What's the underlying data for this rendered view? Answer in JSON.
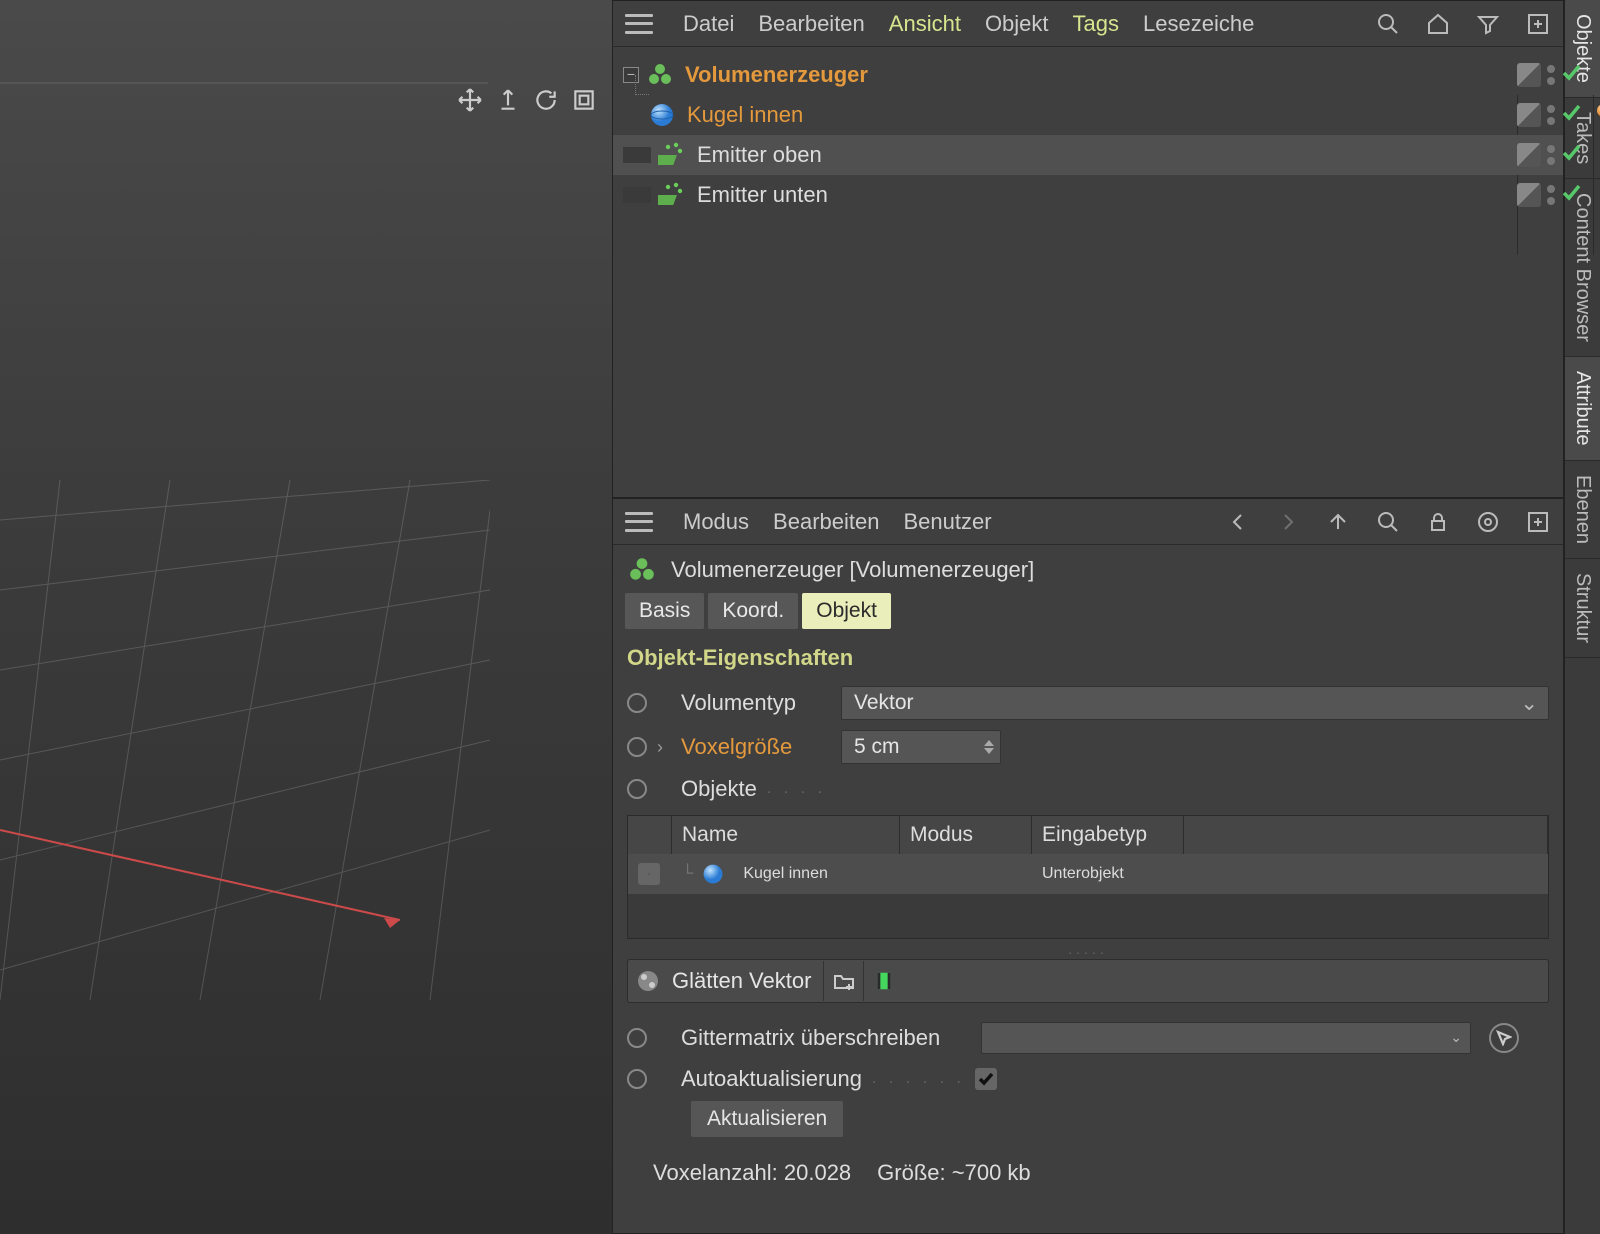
{
  "viewport_tools": {
    "move": "move-icon",
    "lift": "lift-icon",
    "rotate": "rotate-icon",
    "frame": "frame-icon"
  },
  "objmgr": {
    "menu": {
      "datei": "Datei",
      "bearbeiten": "Bearbeiten",
      "ansicht": "Ansicht",
      "objekt": "Objekt",
      "tags": "Tags",
      "lesezeiche": "Lesezeiche"
    },
    "tree": {
      "items": [
        {
          "name": "Volumenerzeuger",
          "orange": true,
          "bold": true
        },
        {
          "name": "Kugel innen",
          "orange": true
        },
        {
          "name": "Emitter oben"
        },
        {
          "name": "Emitter unten"
        }
      ]
    }
  },
  "attr": {
    "menu": {
      "modus": "Modus",
      "bearbeiten": "Bearbeiten",
      "benutzer": "Benutzer"
    },
    "title": "Volumenerzeuger [Volumenerzeuger]",
    "tabs": {
      "basis": "Basis",
      "koord": "Koord.",
      "objekt": "Objekt"
    },
    "section": "Objekt-Eigenschaften",
    "props": {
      "volumentyp_label": "Volumentyp",
      "volumentyp_value": "Vektor",
      "voxelgroesse_label": "Voxelgröße",
      "voxelgroesse_value": "5 cm",
      "objekte_label": "Objekte",
      "table": {
        "h_name": "Name",
        "h_modus": "Modus",
        "h_eingabetyp": "Eingabetyp",
        "r0_name": "Kugel innen",
        "r0_type": "Unterobjekt"
      },
      "glaetten": "Glätten Vektor",
      "gittermatrix": "Gittermatrix überschreiben",
      "autoaktual": "Autoaktualisierung",
      "aktualisieren": "Aktualisieren"
    },
    "status": {
      "voxel": "Voxelanzahl: 20.028",
      "groesse": "Größe: ~700 kb"
    }
  },
  "sidetabs": {
    "objekte": "Objekte",
    "takes": "Takes",
    "content": "Content Browser",
    "attribute": "Attribute",
    "ebenen": "Ebenen",
    "struktur": "Struktur"
  }
}
